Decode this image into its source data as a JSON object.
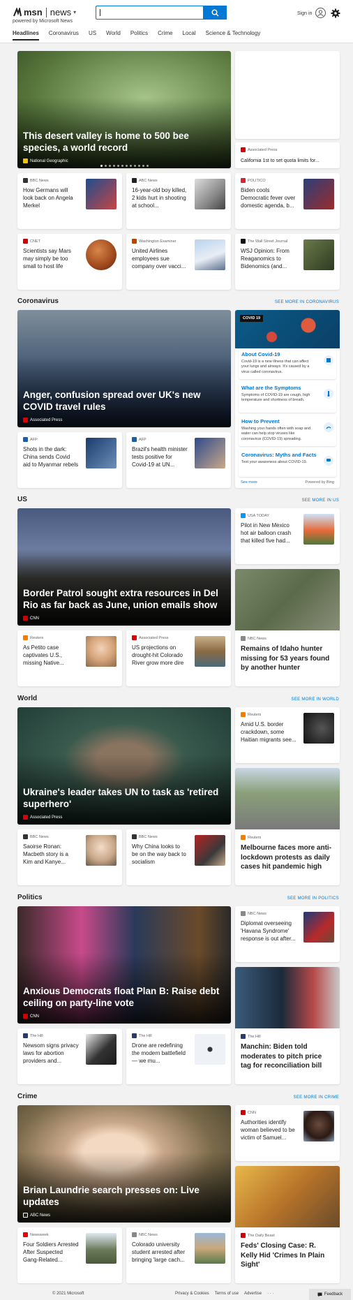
{
  "header": {
    "brand_msn": "msn",
    "brand_news": "news",
    "powered_by": "powered by Microsoft News",
    "search_placeholder": "",
    "signin": "Sign in"
  },
  "nav": [
    "Headlines",
    "Coronavirus",
    "US",
    "World",
    "Politics",
    "Crime",
    "Local",
    "Science & Technology"
  ],
  "top": {
    "hero": {
      "title": "This desert valley is home to 500 bee species, a world record",
      "source": "National Geographic"
    },
    "side_small": {
      "source": "Associated Press",
      "title": "California 1st to set quota limits for..."
    },
    "row1": [
      {
        "source": "BBC News",
        "title": "How Germans will look back on Angela Merkel"
      },
      {
        "source": "ABC News",
        "title": "16-year-old boy killed, 2 kids hurt in shooting at school..."
      },
      {
        "source": "POLITICO",
        "title": "Biden cools Democratic fever over domestic agenda, b..."
      }
    ],
    "row2": [
      {
        "source": "CNET",
        "title": "Scientists say Mars may simply be too small to host life"
      },
      {
        "source": "Washington Examiner",
        "title": "United Airlines employees sue company over vacci..."
      },
      {
        "source": "The Wall Street Journal",
        "title": "WSJ Opinion: From Reaganomics to Bidenomics (and..."
      }
    ]
  },
  "sections": {
    "coronavirus": {
      "title": "Coronavirus",
      "see_more": "SEE MORE IN CORONAVIRUS",
      "hero": {
        "title": "Anger, confusion spread over UK's new COVID travel rules",
        "source": "Associated Press"
      },
      "row": [
        {
          "source": "AFP",
          "title": "Shots in the dark: China sends Covid aid to Myanmar rebels"
        },
        {
          "source": "AFP",
          "title": "Brazil's health minister tests positive for Covid-19 at UN..."
        }
      ],
      "widget": {
        "badge": "COVID 19",
        "items": [
          {
            "h": "About Covid-19",
            "d": "Covid-19 is a new illness that can affect your lungs and airways. It's caused by a virus called coronavirus."
          },
          {
            "h": "What are the Symptoms",
            "d": "Symptoms of COVID-19 are cough, high temperature and shortness of breath."
          },
          {
            "h": "How to Prevent",
            "d": "Washing your hands often with soap and water can help stop viruses like coronavirus (COVID-19) spreading."
          },
          {
            "h": "Coronavirus: Myths and Facts",
            "d": "Test your awareness about COVID-19."
          }
        ],
        "see_more": "See more",
        "powered": "Powered by Bing"
      }
    },
    "us": {
      "title": "US",
      "see_more": "SEE MORE IN US",
      "hero": {
        "title": "Border Patrol sought extra resources in Del Rio as far back as June, union emails show",
        "source": "CNN"
      },
      "side": {
        "source": "USA TODAY",
        "title": "Pilot in New Mexico hot air balloon crash that killed five had..."
      },
      "row": [
        {
          "source": "Reuters",
          "title": "As Petito case captivates U.S., missing Native..."
        },
        {
          "source": "Associated Press",
          "title": "US projections on drought-hit Colorado River grow more dire"
        }
      ],
      "tall": {
        "source": "NBC News",
        "title": "Remains of Idaho hunter missing for 53 years found by another hunter"
      }
    },
    "world": {
      "title": "World",
      "see_more": "SEE MORE IN WORLD",
      "hero": {
        "title": "Ukraine's leader takes UN to task as 'retired superhero'",
        "source": "Associated Press"
      },
      "side": {
        "source": "Reuters",
        "title": "Amid U.S. border crackdown, some Haitian migrants see..."
      },
      "row": [
        {
          "source": "BBC News",
          "title": "Saoirse Ronan: Macbeth story is a Kim and Kanye..."
        },
        {
          "source": "BBC News",
          "title": "Why China looks to be on the way back to socialism"
        }
      ],
      "tall": {
        "source": "Reuters",
        "title": "Melbourne faces more anti-lockdown protests as daily cases hit pandemic high"
      }
    },
    "politics": {
      "title": "Politics",
      "see_more": "SEE MORE IN POLITICS",
      "hero": {
        "title": "Anxious Democrats float Plan B: Raise debt ceiling on party-line vote",
        "source": "CNN"
      },
      "side": {
        "source": "NBC News",
        "title": "Diplomat overseeing 'Havana Syndrome' response is out after..."
      },
      "row": [
        {
          "source": "The Hill",
          "title": "Newsom signs privacy laws for abortion providers and..."
        },
        {
          "source": "The Hill",
          "title": "Drone are redefining the modern battlefield — we mu..."
        }
      ],
      "tall": {
        "source": "The Hill",
        "title": "Manchin: Biden told moderates to pitch price tag for reconciliation bill"
      }
    },
    "crime": {
      "title": "Crime",
      "see_more": "SEE MORE IN CRIME",
      "hero": {
        "title": "Brian Laundrie search presses on: Live updates",
        "source": "ABC News"
      },
      "side": {
        "source": "CNN",
        "title": "Authorities identify woman believed to be victim of Samuel..."
      },
      "row": [
        {
          "source": "Newsweek",
          "title": "Four Soldiers Arrested After Suspected Gang-Related..."
        },
        {
          "source": "NBC News",
          "title": "Colorado university student arrested after bringing 'large cach..."
        }
      ],
      "tall": {
        "source": "The Daily Beast",
        "title": "Feds' Closing Case: R. Kelly Hid 'Crimes In Plain Sight'"
      }
    }
  },
  "footer": {
    "copyright": "© 2021 Microsoft",
    "links": [
      "Privacy & Cookies",
      "Terms of use",
      "Advertise",
      "· · ·"
    ],
    "feedback": "Feedback"
  },
  "colors": {
    "accent": "#0078d4"
  }
}
